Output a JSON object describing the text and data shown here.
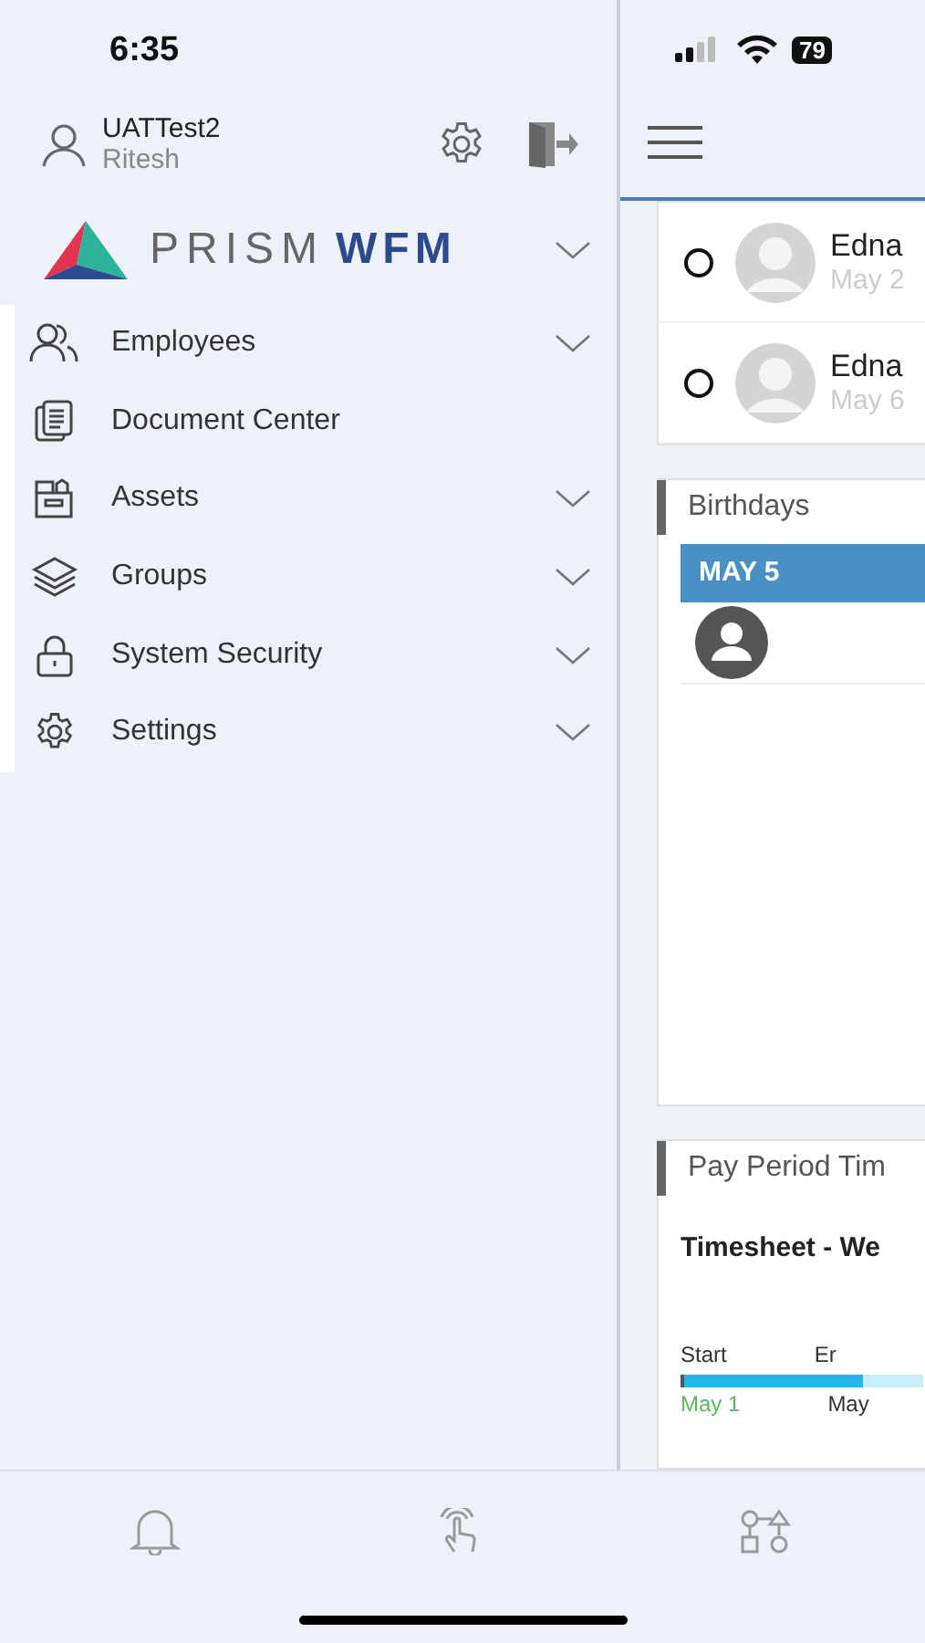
{
  "status_bar": {
    "time": "6:35",
    "battery": "79"
  },
  "drawer": {
    "user": {
      "name": "UATTest2",
      "subtitle": "Ritesh"
    },
    "logo": {
      "part_1": "PRISM",
      "part_2": "WFM"
    },
    "menu": [
      {
        "label": "Employees",
        "kind": "people",
        "expandable": true
      },
      {
        "label": "Document Center",
        "kind": "document",
        "expandable": false
      },
      {
        "label": "Assets",
        "kind": "box",
        "expandable": true
      },
      {
        "label": "Groups",
        "kind": "layers",
        "expandable": true
      },
      {
        "label": "System Security",
        "kind": "lock",
        "expandable": true
      },
      {
        "label": "Settings",
        "kind": "gear",
        "expandable": true
      }
    ]
  },
  "main": {
    "list": [
      {
        "name": "Edna",
        "date": "May 2",
        "selected": false
      },
      {
        "name": "Edna",
        "date": "May 6",
        "selected": false
      }
    ],
    "birthdays": {
      "title": "Birthdays",
      "date": "MAY 5"
    },
    "pay_period": {
      "title": "Pay Period Tim",
      "timesheet": "Timesheet - We",
      "start_label": "Start",
      "end_label": "Er",
      "start_date": "May 1",
      "end_date": "May",
      "level": 0.75
    }
  },
  "tab_bar": [
    {
      "kind": "bell"
    },
    {
      "kind": "tap"
    },
    {
      "kind": "workflow"
    }
  ]
}
